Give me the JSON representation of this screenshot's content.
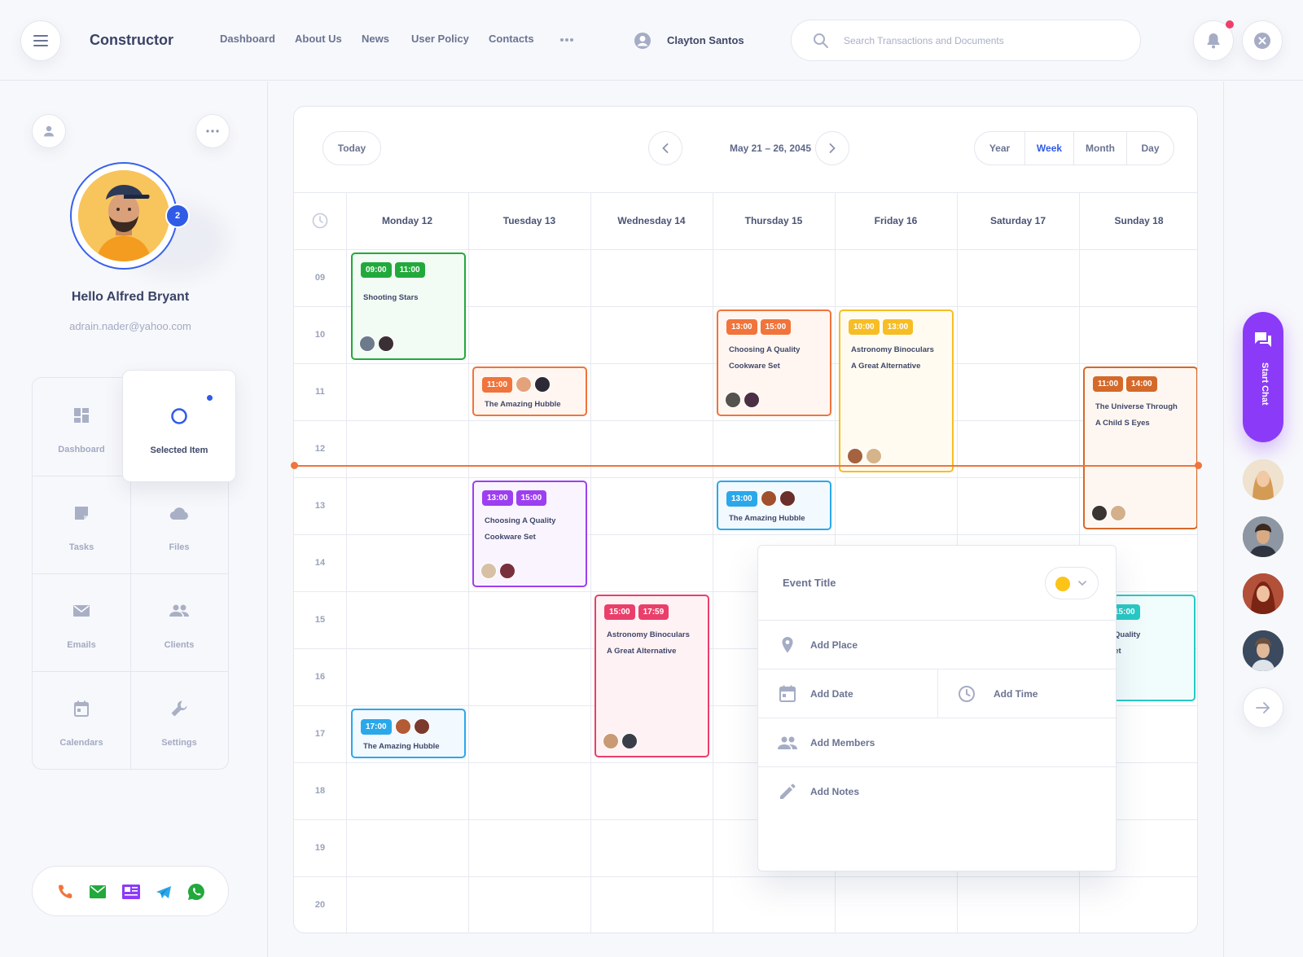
{
  "header": {
    "brand": "Constructor",
    "nav": [
      "Dashboard",
      "About Us",
      "News",
      "User Policy",
      "Contacts"
    ],
    "user_name": "Clayton Santos",
    "search_placeholder": "Search Transactions and Documents"
  },
  "profile": {
    "badge": "2",
    "hello": "Hello Alfred Bryant",
    "email": "adrain.nader@yahoo.com"
  },
  "menu": {
    "dashboard": "Dashboard",
    "selected": "Selected Item",
    "tasks": "Tasks",
    "files": "Files",
    "emails": "Emails",
    "clients": "Clients",
    "calendars": "Calendars",
    "settings": "Settings"
  },
  "calendar": {
    "today": "Today",
    "range": "May 21 – 26, 2045",
    "views": [
      "Year",
      "Week",
      "Month",
      "Day"
    ],
    "active_view": "Week",
    "days": [
      "Monday 12",
      "Tuesday 13",
      "Wednesday 14",
      "Thursday 15",
      "Friday 16",
      "Saturday 17",
      "Sunday 18"
    ],
    "hours": [
      "09",
      "10",
      "11",
      "12",
      "13",
      "14",
      "15",
      "16",
      "17",
      "18",
      "19",
      "20"
    ]
  },
  "events": {
    "e1": {
      "start": "09:00",
      "end": "11:00",
      "title": "Shooting Stars",
      "color": "#22a93c"
    },
    "e2": {
      "start": "11:00",
      "title": "The Amazing Hubble",
      "color": "#f0743b"
    },
    "e3": {
      "start": "13:00",
      "end": "15:00",
      "title1": "Choosing A Quality",
      "title2": "Cookware Set",
      "color": "#f0743b"
    },
    "e4": {
      "start": "10:00",
      "end": "13:00",
      "title1": "Astronomy Binoculars",
      "title2": "A Great Alternative",
      "color": "#f6bd25"
    },
    "e5": {
      "start": "11:00",
      "end": "14:00",
      "title1": "The Universe Through",
      "title2": "A Child S Eyes",
      "color": "#d4692a"
    },
    "e6": {
      "start": "13:00",
      "end": "15:00",
      "title1": "Choosing A Quality",
      "title2": "Cookware Set",
      "color": "#9c3ff0"
    },
    "e7": {
      "start": "13:00",
      "title": "The Amazing Hubble",
      "color": "#2aa8ea"
    },
    "e8": {
      "start": "15:00",
      "end": "17:59",
      "title1": "Astronomy Binoculars",
      "title2": "A Great Alternative",
      "color": "#ea3f6b"
    },
    "e9": {
      "start": "15:00",
      "title1": "ng A Quality",
      "title2": "are Set",
      "color": "#27c9c4"
    },
    "e10": {
      "start": "17:00",
      "title": "The Amazing Hubble",
      "color": "#2aa8ea"
    }
  },
  "popup": {
    "title": "Event Title",
    "color": "#fcc419",
    "place": "Add Place",
    "date": "Add Date",
    "time": "Add Time",
    "members": "Add Members",
    "notes": "Add Notes"
  },
  "chat": {
    "label": "Start Chat"
  },
  "colors": {
    "accent": "#2f5be7",
    "now_line": "#f0743b",
    "chat": "#8b3bf7"
  }
}
